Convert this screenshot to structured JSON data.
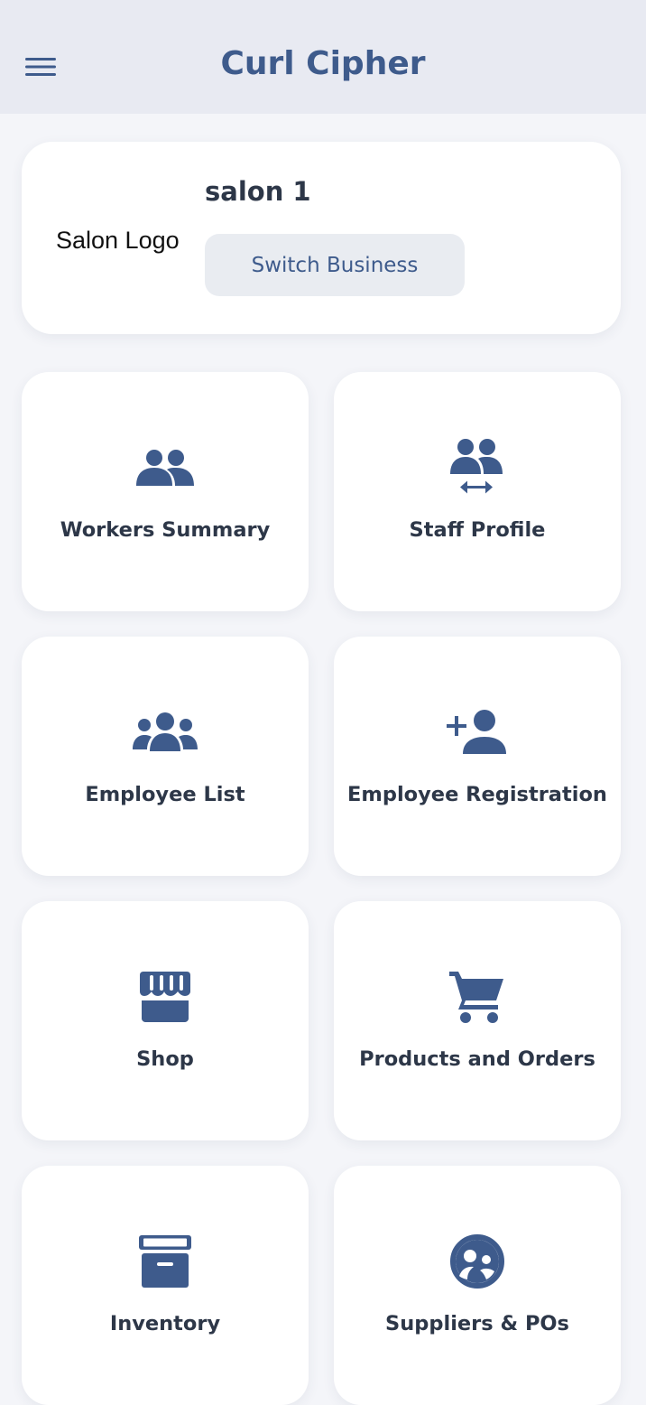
{
  "app": {
    "title": "Curl Cipher",
    "accent_color": "#3e5b8c",
    "menu_icon": "hamburger-menu-icon"
  },
  "business": {
    "logo_text": "Salon Logo",
    "name": "salon 1",
    "switch_label": "Switch Business"
  },
  "tiles": [
    {
      "label": "Workers Summary",
      "icon": "people-group-icon"
    },
    {
      "label": "Staff Profile",
      "icon": "people-swap-icon"
    },
    {
      "label": "Employee List",
      "icon": "group-three-people-icon"
    },
    {
      "label": "Employee Registration",
      "icon": "person-add-icon"
    },
    {
      "label": "Shop",
      "icon": "storefront-icon"
    },
    {
      "label": "Products and Orders",
      "icon": "shopping-cart-icon"
    },
    {
      "label": "Inventory",
      "icon": "archive-box-icon"
    },
    {
      "label": "Suppliers & POs",
      "icon": "supplier-face-icon"
    }
  ]
}
